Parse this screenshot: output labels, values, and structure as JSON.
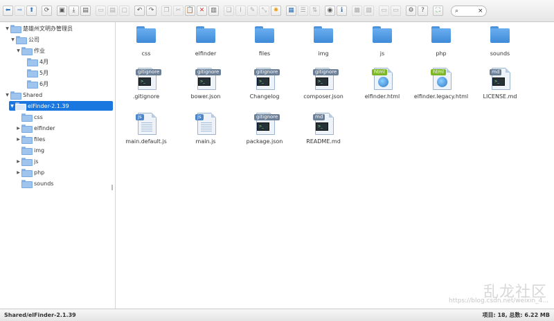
{
  "toolbar": {
    "groups": [
      [
        "back-icon",
        "forward-icon",
        "up-icon"
      ],
      [
        "reload-icon"
      ],
      [
        "open-icon",
        "download-icon",
        "get-info-icon"
      ],
      [
        "quicklook-icon",
        "save-icon",
        "new-file-icon"
      ],
      [
        "undo-icon",
        "redo-icon"
      ],
      [
        "copy-icon",
        "cut-icon",
        "paste-icon",
        "delete-icon",
        "trash-icon"
      ],
      [
        "duplicate-icon",
        "rename-icon",
        "edit-icon",
        "resize-icon",
        "extract-icon"
      ],
      [
        "icons-view-icon",
        "list-view-icon",
        "sort-icon"
      ],
      [
        "preview-icon",
        "info-icon"
      ],
      [
        "archive-icon",
        "extract-archive-icon"
      ],
      [
        "places-icon",
        "netmount-icon"
      ],
      [
        "settings-icon",
        "help-icon"
      ],
      [
        "fullscreen-icon"
      ]
    ],
    "search_placeholder": "",
    "search_clear": "×"
  },
  "tree": [
    {
      "label": "楚雄州文明办管理员",
      "icon": "folder-icon",
      "expanded": true
    },
    {
      "label": "公司",
      "icon": "folder-icon",
      "expanded": true
    },
    {
      "label": "作业",
      "icon": "folder-icon",
      "expanded": true
    },
    {
      "label": "4月",
      "icon": "folder-icon"
    },
    {
      "label": "5月",
      "icon": "folder-icon"
    },
    {
      "label": "6月",
      "icon": "folder-icon"
    },
    {
      "label": "Shared",
      "icon": "folder-icon",
      "expanded": true
    },
    {
      "label": "elFinder-2.1.39",
      "icon": "folder-icon",
      "expanded": true,
      "selected": true
    },
    {
      "label": "css",
      "icon": "folder-icon"
    },
    {
      "label": "elfinder",
      "icon": "folder-icon",
      "collapsed": true
    },
    {
      "label": "files",
      "icon": "folder-icon",
      "collapsed": true
    },
    {
      "label": "img",
      "icon": "folder-icon"
    },
    {
      "label": "js",
      "icon": "folder-icon",
      "collapsed": true
    },
    {
      "label": "php",
      "icon": "folder-icon",
      "collapsed": true
    },
    {
      "label": "sounds",
      "icon": "folder-icon"
    }
  ],
  "resize_handle": "‖",
  "files": [
    {
      "name": "css",
      "kind": "folder"
    },
    {
      "name": "elfinder",
      "kind": "folder"
    },
    {
      "name": "files",
      "kind": "folder"
    },
    {
      "name": "img",
      "kind": "folder"
    },
    {
      "name": "js",
      "kind": "folder"
    },
    {
      "name": "php",
      "kind": "folder"
    },
    {
      "name": "sounds",
      "kind": "folder"
    },
    {
      "name": ".gitignore",
      "kind": "terminal",
      "tag": "gitignore"
    },
    {
      "name": "bower.json",
      "kind": "terminal",
      "tag": "gitignore"
    },
    {
      "name": "Changelog",
      "kind": "terminal",
      "tag": "gitignore"
    },
    {
      "name": "composer.json",
      "kind": "terminal",
      "tag": "gitignore"
    },
    {
      "name": "elfinder.html",
      "kind": "html",
      "tag": "html"
    },
    {
      "name": "elfinder.legacy.html",
      "kind": "html",
      "tag": "html"
    },
    {
      "name": "LICENSE.md",
      "kind": "terminal",
      "tag": "md"
    },
    {
      "name": "main.default.js",
      "kind": "js",
      "tag": "js"
    },
    {
      "name": "main.js",
      "kind": "js",
      "tag": "js"
    },
    {
      "name": "package.json",
      "kind": "terminal",
      "tag": "gitignore"
    },
    {
      "name": "README.md",
      "kind": "terminal",
      "tag": "md"
    }
  ],
  "status": {
    "path": "Shared/elFinder-2.1.39",
    "stats": "项目: 18, 总数: 6.22 MB"
  },
  "watermark": "https://blog.csdn.net/weixin_4...",
  "logo_text": "乱龙社区"
}
